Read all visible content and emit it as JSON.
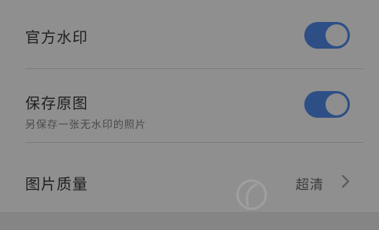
{
  "settings": {
    "official_watermark": {
      "title": "官方水印",
      "enabled": true
    },
    "save_original": {
      "title": "保存原图",
      "subtitle": "另保存一张无水印的照片",
      "enabled": true
    },
    "image_quality": {
      "title": "图片质量",
      "value": "超清"
    }
  },
  "colors": {
    "background": "#8f8f8f",
    "toggle_on": "#2e4f86",
    "toggle_knob": "#8e8e8e",
    "text_primary": "#1f1f1f",
    "text_secondary": "#4a4a4a"
  },
  "icons": {
    "chevron": "chevron-right-icon",
    "watermark": "watermark-logo"
  }
}
